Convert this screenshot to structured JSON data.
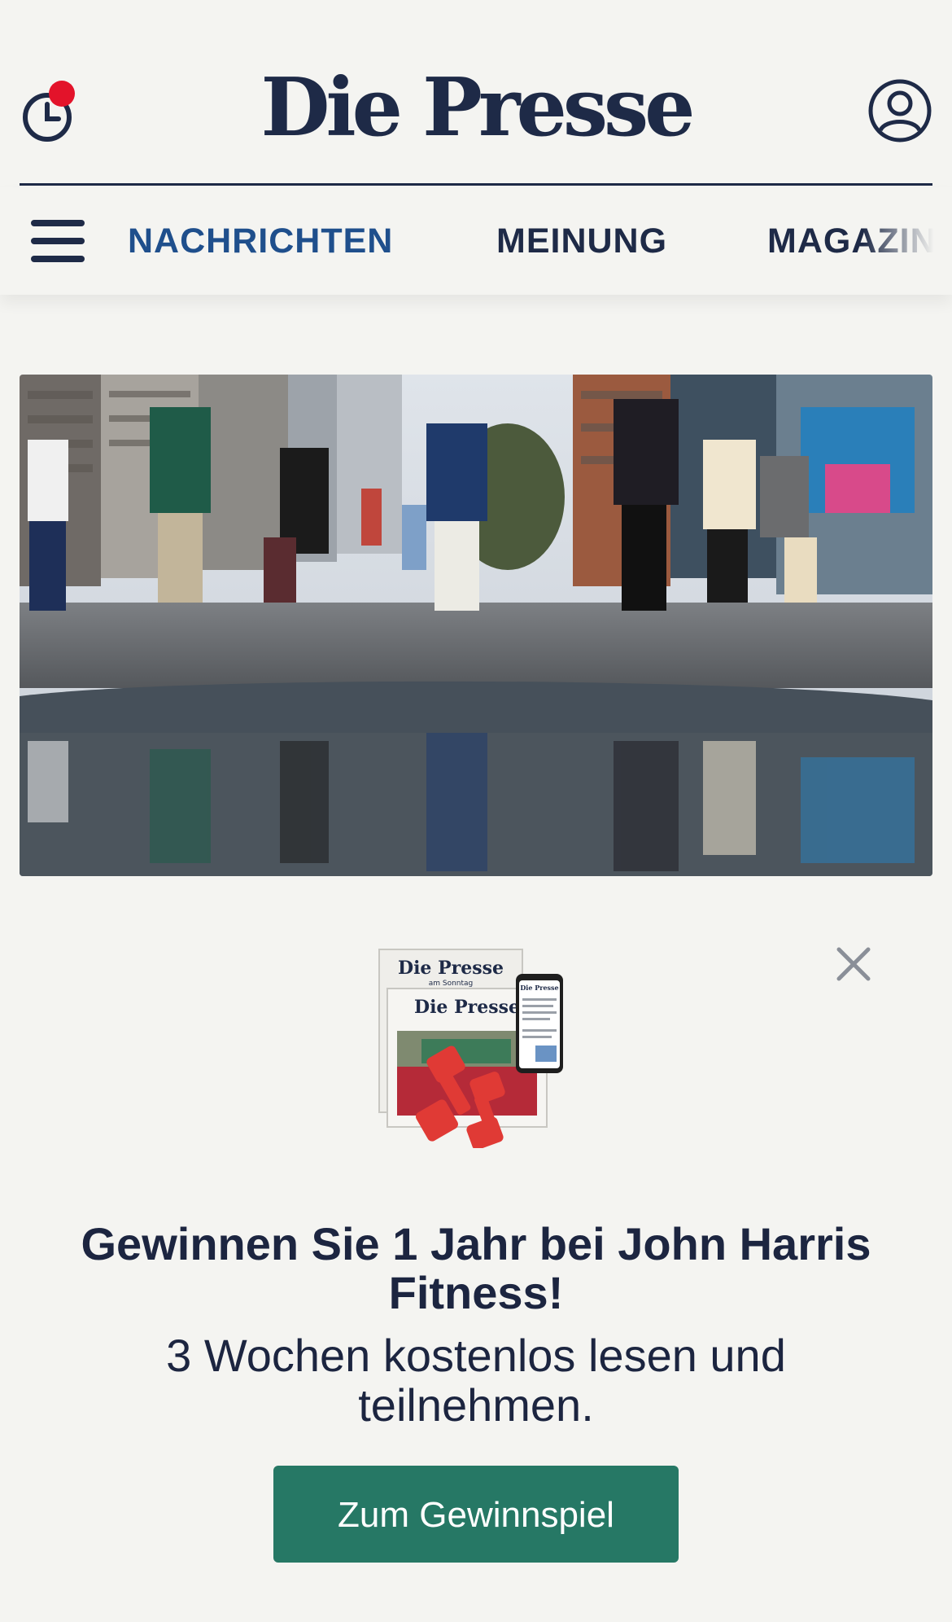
{
  "header": {
    "logo": "Die Presse",
    "history_icon": "clock-icon",
    "account_icon": "user-circle-icon",
    "notification_color": "#e3132a"
  },
  "nav": {
    "menu_icon": "hamburger-icon",
    "items": [
      {
        "label": "NACHRICHTEN",
        "active": true
      },
      {
        "label": "MEINUNG",
        "active": false
      },
      {
        "label": "MAGAZIN",
        "active": false
      }
    ],
    "active_color": "#1f4f8c"
  },
  "article": {
    "image_description_icon": "street-photo"
  },
  "promo": {
    "close_icon": "close-icon",
    "image": {
      "paper1_title": "Die Presse",
      "paper1_sub": "am Sonntag",
      "paper2_title": "Die Presse",
      "phone_title": "Die Presse"
    },
    "title": "Gewinnen Sie 1 Jahr bei John Harris Fitness!",
    "subtitle": "3 Wochen kostenlos lesen und teilnehmen.",
    "cta_label": "Zum Gewinnspiel",
    "cta_color": "#267865"
  }
}
